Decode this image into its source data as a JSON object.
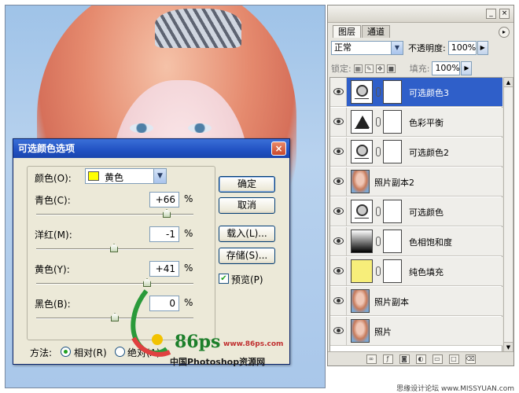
{
  "layers_panel": {
    "tabs": [
      "图层",
      "通道"
    ],
    "blend_mode": "正常",
    "opacity_label": "不透明度:",
    "opacity_value": "100%",
    "lock_label": "锁定:",
    "fill_label": "填充:",
    "fill_value": "100%",
    "layers": [
      {
        "name": "可选颜色3",
        "type": "selective-color",
        "selected": true
      },
      {
        "name": "色彩平衡",
        "type": "color-balance",
        "selected": false
      },
      {
        "name": "可选颜色2",
        "type": "selective-color",
        "selected": false
      },
      {
        "name": "照片副本2",
        "type": "photo",
        "selected": false
      },
      {
        "name": "可选颜色",
        "type": "selective-color",
        "selected": false
      },
      {
        "name": "色相饱和度",
        "type": "hue-saturation",
        "selected": false
      },
      {
        "name": "纯色填充",
        "type": "solid-fill",
        "selected": false
      },
      {
        "name": "照片副本",
        "type": "photo",
        "selected": false
      },
      {
        "name": "照片",
        "type": "photo",
        "selected": false
      }
    ]
  },
  "dialog": {
    "title": "可选颜色选项",
    "colors_label": "颜色(O):",
    "colors_value": "黄色",
    "colors_swatch": "#ffff00",
    "sliders": [
      {
        "label": "青色(C):",
        "value": "+66",
        "unit": "%",
        "fraction": 0.83
      },
      {
        "label": "洋红(M):",
        "value": "-1",
        "unit": "%",
        "fraction": 0.495
      },
      {
        "label": "黄色(Y):",
        "value": "+41",
        "unit": "%",
        "fraction": 0.705
      },
      {
        "label": "黑色(B):",
        "value": "0",
        "unit": "%",
        "fraction": 0.5
      }
    ],
    "buttons": {
      "ok": "确定",
      "cancel": "取消",
      "load": "载入(L)...",
      "save": "存储(S)..."
    },
    "preview_label": "预览(P)",
    "preview_checked": true,
    "method_label": "方法:",
    "method_relative": "相对(R)",
    "method_absolute": "绝对(A)",
    "method_selected": "relative"
  },
  "watermark": {
    "brand": "86ps",
    "site": "www.86ps.com",
    "cn": "中国Photoshop资源网"
  },
  "credit": "思缘设计论坛 www.MISSYUAN.com",
  "colors": {
    "titlebar": "#2151c2",
    "selected_layer": "#2f5fc9",
    "dialog_bg": "#ece9d8",
    "panel_bg": "#e8e6df"
  }
}
